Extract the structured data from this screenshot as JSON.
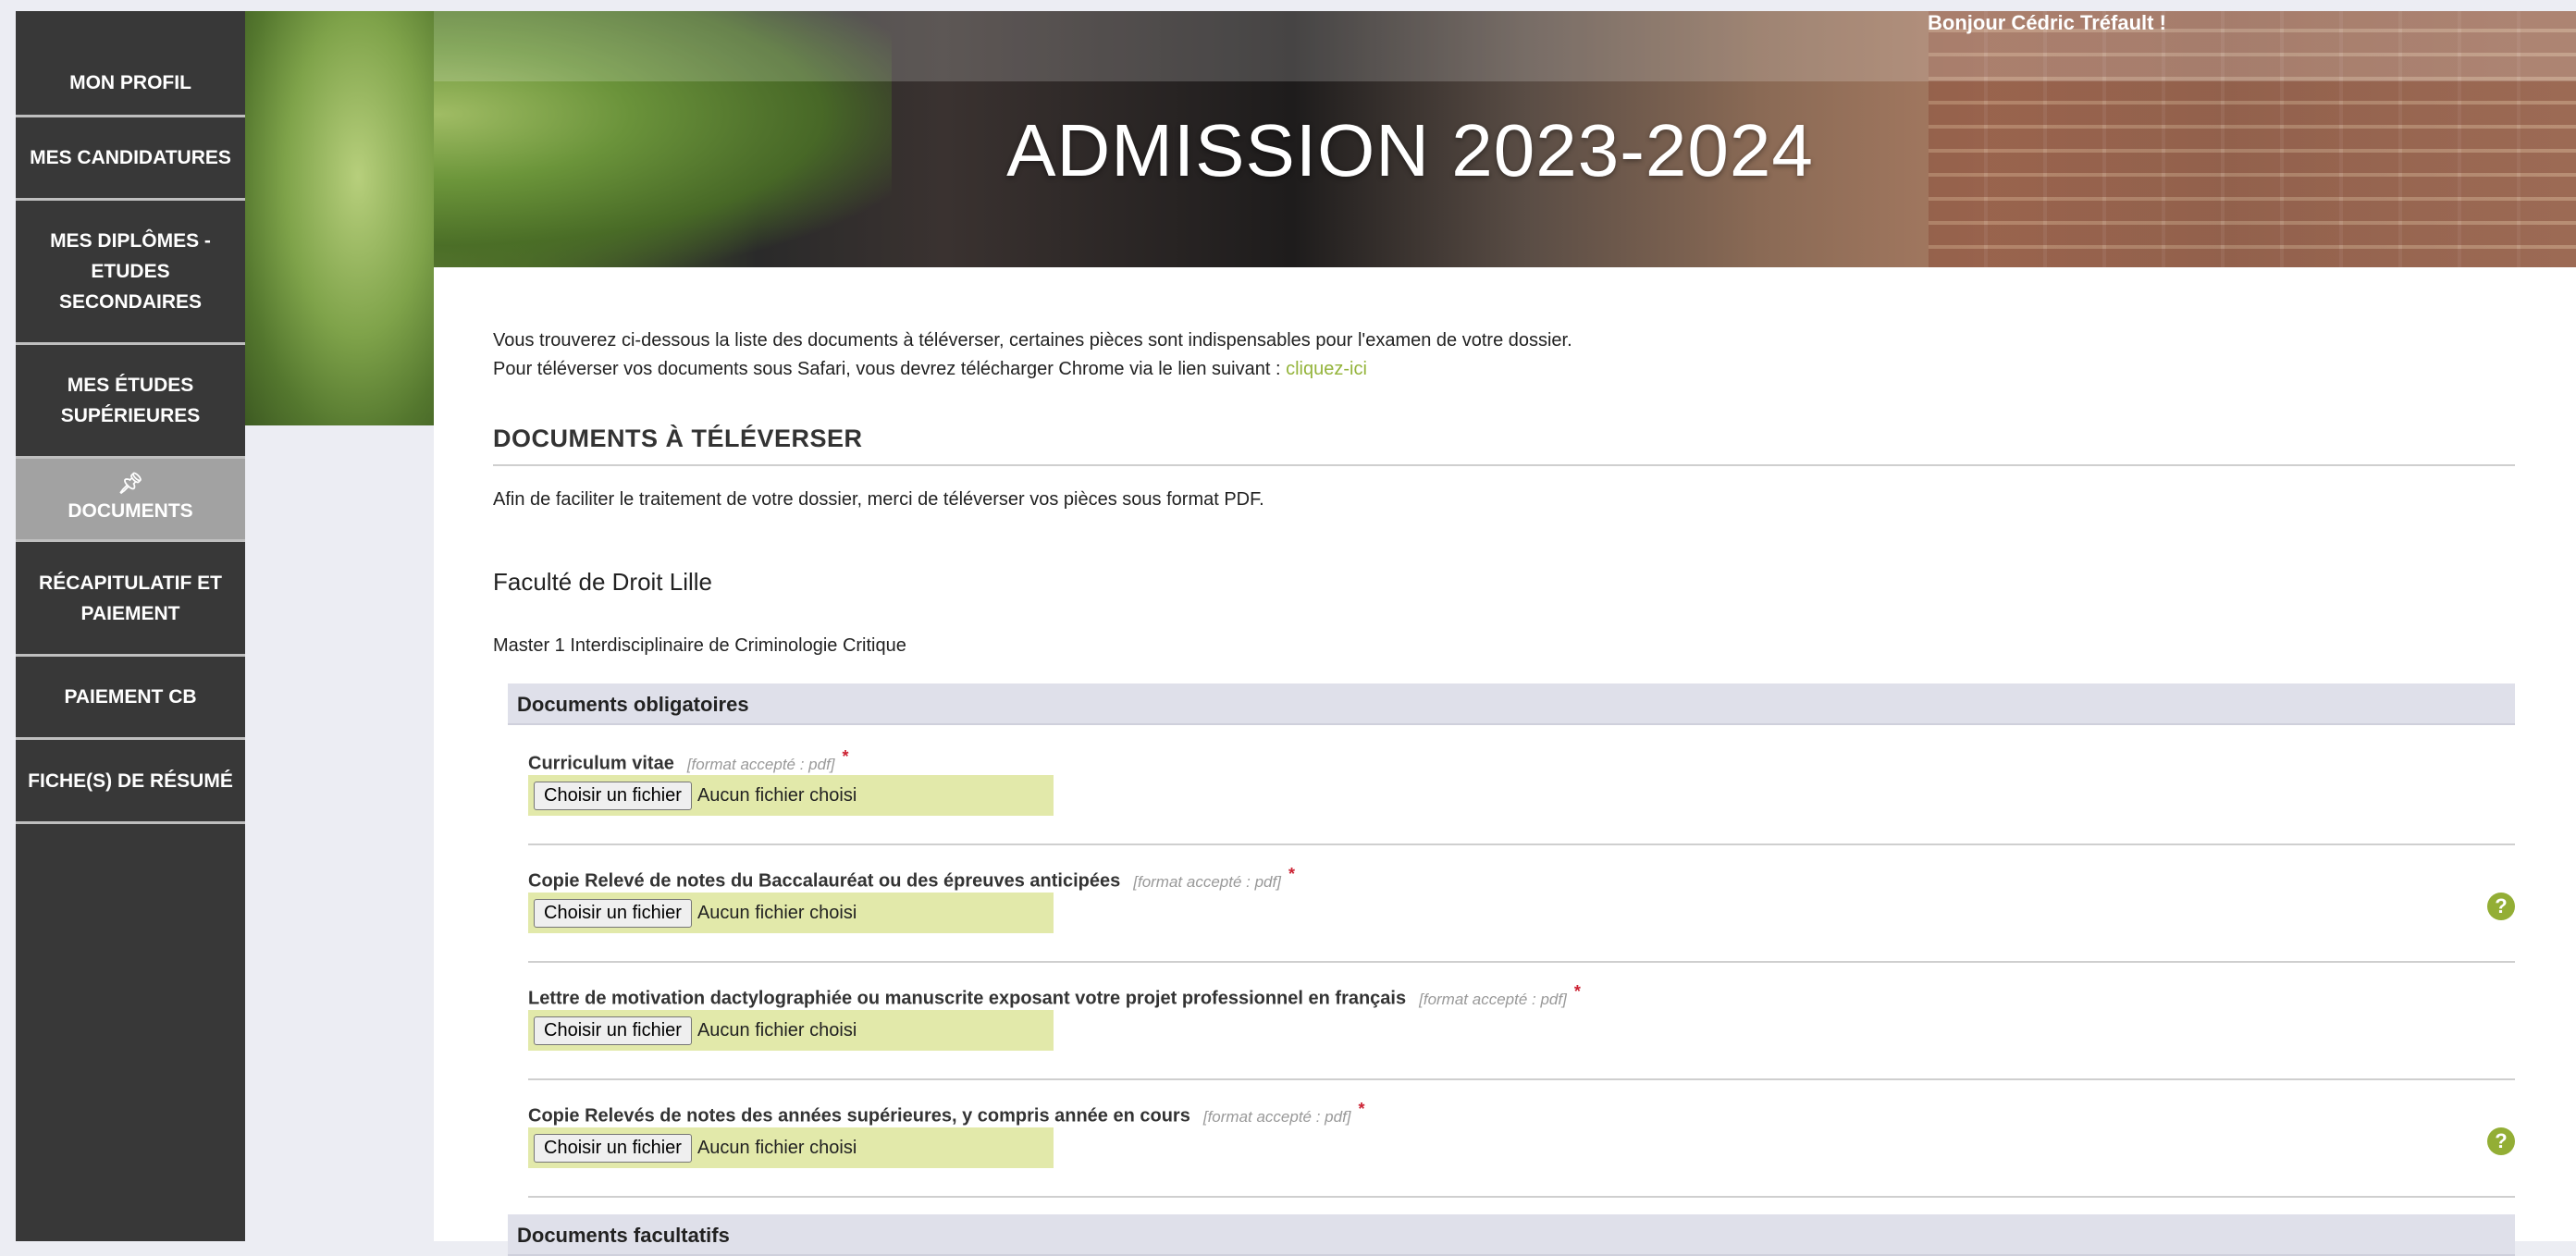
{
  "header": {
    "greeting": "Bonjour Cédric Tréfault !",
    "title": "ADMISSION 2023-2024"
  },
  "sidebar": {
    "items": [
      {
        "label": "MON PROFIL"
      },
      {
        "label": "MES CANDIDATURES"
      },
      {
        "label": "MES DIPLÔMES - ETUDES SECONDAIRES"
      },
      {
        "label": "MES ÉTUDES SUPÉRIEURES"
      },
      {
        "label": "DOCUMENTS",
        "icon": "pin-icon",
        "active": true
      },
      {
        "label": "RÉCAPITULATIF ET PAIEMENT"
      },
      {
        "label": "PAIEMENT CB"
      },
      {
        "label": "FICHE(S) DE RÉSUMÉ"
      }
    ]
  },
  "intro": {
    "line1": "Vous trouverez ci-dessous la liste des documents à téléverser, certaines pièces sont indispensables pour l'examen de votre dossier.",
    "line2": "Pour téléverser vos documents sous Safari, vous devrez télécharger Chrome via le lien suivant :",
    "link": "cliquez-ici"
  },
  "section": {
    "title": "DOCUMENTS À TÉLÉVERSER",
    "pdf_note": "Afin de faciliter le traitement de votre dossier, merci de téléverser vos pièces sous format PDF."
  },
  "faculte": "Faculté de Droit Lille",
  "program": "Master 1 Interdisciplinaire de Criminologie Critique",
  "groups": {
    "mandatory": "Documents obligatoires",
    "optional": "Documents facultatifs"
  },
  "file_input": {
    "button": "Choisir un fichier",
    "empty": "Aucun fichier choisi"
  },
  "documents": [
    {
      "label": "Curriculum vitae",
      "format": "[format accepté : pdf]",
      "required": "*",
      "help": false
    },
    {
      "label": "Copie Relevé de notes du Baccalauréat ou des épreuves anticipées",
      "format": "[format accepté : pdf]",
      "required": "*",
      "help": true
    },
    {
      "label": "Lettre de motivation dactylographiée ou manuscrite exposant votre projet professionnel en français",
      "format": "[format accepté : pdf]",
      "required": "*",
      "help": false
    },
    {
      "label": "Copie Relevés de notes des années supérieures, y compris année en cours",
      "format": "[format accepté : pdf]",
      "required": "*",
      "help": true
    }
  ],
  "help_glyph": "?",
  "colors": {
    "accent": "#94b43b",
    "sidebar": "#383838",
    "file_bg": "#e2e9aa"
  }
}
